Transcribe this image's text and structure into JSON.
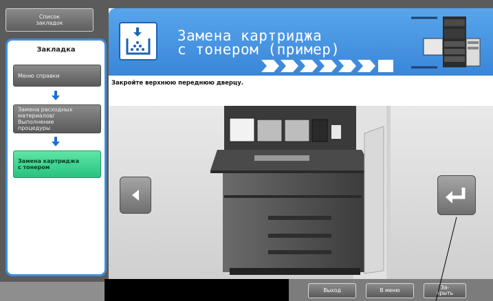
{
  "sidebar": {
    "bookmark_list_label": "Список\nзакладок",
    "title": "Закладка",
    "items": [
      {
        "label": "Меню справки"
      },
      {
        "label": "Замена расходных\nматериалов/\nВыполнение\nпроцедуры"
      },
      {
        "label": "Замена картриджа\nс тонером"
      }
    ]
  },
  "header": {
    "title": "Замена картриджа\nс тонером (пример)",
    "progress_steps": 7,
    "progress_done": 6
  },
  "main": {
    "instruction": "Закройте верхнюю переднюю дверцу."
  },
  "footer": {
    "exit_label": "Выход",
    "menu_label": "В меню",
    "close_label": "За-\nкрыть"
  },
  "colors": {
    "header_blue": "#3a86d8",
    "sidebar_border": "#3b8fe0",
    "active_green": "#27c27f",
    "arrow_blue": "#1f6fd0"
  },
  "icons": {
    "toner_icon": "toner-drop-icon",
    "back": "arrow-left-icon",
    "return": "return-arrow-icon",
    "down": "arrow-down-icon"
  }
}
